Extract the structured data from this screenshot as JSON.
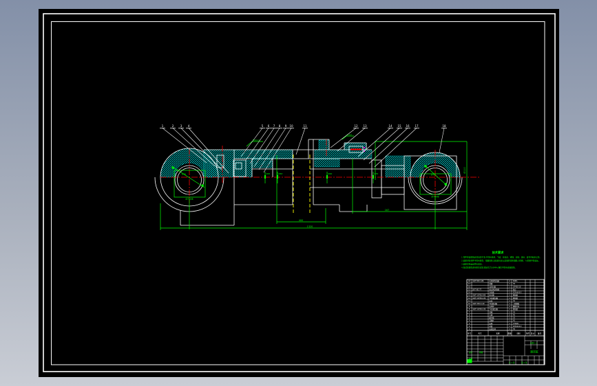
{
  "app": {
    "type": "cad-drawing-preview"
  },
  "colors": {
    "background_top": "#8390a8",
    "background_bottom": "#c9cdd5",
    "sheet": "#000000",
    "frame": "#ffffff",
    "hatch": "#00dcdc",
    "dimension": "#00ff00",
    "centerline": "#ff0000",
    "hidden_line": "#ffff00",
    "detail_dot": "#ff00ff"
  },
  "drawing": {
    "callouts": [
      "1",
      "2",
      "3",
      "4",
      "5",
      "6",
      "7",
      "8",
      "9",
      "10",
      "11",
      "12",
      "13",
      "14",
      "15",
      "16",
      "17",
      "18"
    ],
    "dimensions": {
      "overall_length": "1320",
      "stroke": "400",
      "head_length": "167",
      "right_vertical": "Ø110",
      "rod_dia_marks": [
        "Ø45",
        "Ø63",
        "Ø40",
        "Ø55"
      ],
      "left_eye_dia": "Ø70H8",
      "right_eye_dia": "Ø70H8",
      "left_eye_diag": "Ø70",
      "right_eye_diag": "Ø70",
      "thread_leader": "M10×1",
      "taper": "1:12"
    }
  },
  "notes": {
    "title": "技术要求",
    "lines": [
      "1.零件在装配前必须清洗干净,不得有毛刺、飞边、氧化皮、锈蚀、切屑、油污、着色剂和灰尘等。",
      "2.装配时密封件不得有擦伤、扭曲现象,安装前应涂以适量的润滑油脂,O形圈、Yx形圈不得装反。",
      "3.装配后各运动件应灵活。",
      "4.按试验规程进行耐压试验,额定压力16MPa,保压不得有渗漏现象。"
    ]
  },
  "parts_table": {
    "headers": [
      "序号",
      "代号",
      "名称",
      "数量",
      "材料",
      "单件",
      "总计",
      "备注"
    ],
    "rows": [
      [
        "18",
        "GB/T 893.1-86",
        "孔用弹性挡圈",
        "2",
        "65Mn"
      ],
      [
        "17",
        "",
        "挡圈",
        "1",
        "35"
      ],
      [
        "16",
        "",
        "耳环衬套",
        "1",
        "QT450-10"
      ],
      [
        "15",
        "JB/T 982-77",
        "组合密封垫圈",
        "1",
        "组合"
      ],
      [
        "14",
        "",
        "导向套",
        "1",
        "ZQSn6-6-3"
      ],
      [
        "13",
        "GB/T 10708.3-89",
        "防尘圈",
        "1",
        "聚氨酯"
      ],
      [
        "12",
        "GB/T 10708.1-89",
        "Yx形密封圈",
        "1",
        "聚氨酯"
      ],
      [
        "11",
        "",
        "缸盖",
        "1",
        "35"
      ],
      [
        "10",
        "GB/T 3452.1-92",
        "O形密封圈",
        "1",
        "丁腈橡胶"
      ],
      [
        "9",
        "",
        "支承环",
        "2",
        "酚醛夹布"
      ],
      [
        "8",
        "GB/T 10708.1-89",
        "Yx形密封圈",
        "2",
        "聚氨酯"
      ],
      [
        "7",
        "",
        "活塞",
        "1",
        "35"
      ],
      [
        "6",
        "",
        "卡键",
        "2",
        "45"
      ],
      [
        "5",
        "",
        "缓冲套",
        "1",
        "35"
      ],
      [
        "4",
        "",
        "活塞杆",
        "1",
        "45"
      ],
      [
        "3",
        "",
        "缸体",
        "1",
        "27SiMn"
      ],
      [
        "2",
        "",
        "衬套",
        "1",
        "ZQSn6-6-3"
      ],
      [
        "1",
        "",
        "缸底耳环",
        "1",
        "35"
      ]
    ]
  },
  "title_block": {
    "name": "液压缸",
    "green_texts": [
      "设计",
      "制图",
      "校核",
      "比例 1:2",
      "共 1 张",
      "第 1 张"
    ]
  }
}
